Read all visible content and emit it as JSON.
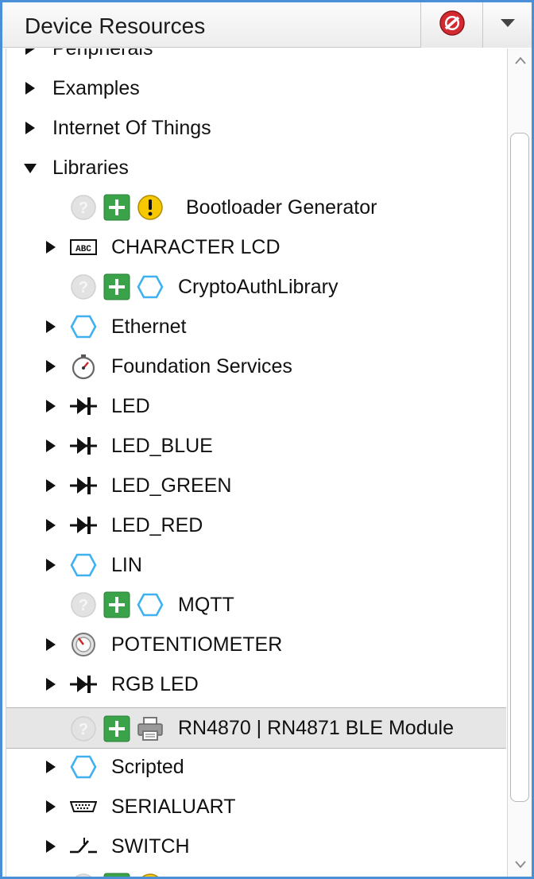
{
  "panel": {
    "title": "Device Resources"
  },
  "header": {
    "stop_icon": "stop-icon",
    "menu_icon": "chevron-down-icon"
  },
  "tree": {
    "partial_top_label": "Peripherals",
    "items": [
      {
        "label": "Examples",
        "icon": "none",
        "expand": "collapsed"
      },
      {
        "label": "Internet Of Things",
        "icon": "none",
        "expand": "collapsed"
      },
      {
        "label": "Libraries",
        "icon": "none",
        "expand": "expanded"
      },
      {
        "label": "Bootloader Generator",
        "icon": "warning-icon",
        "expand": "leaf"
      },
      {
        "label": "CHARACTER LCD",
        "icon": "lcd-icon",
        "expand": "collapsed"
      },
      {
        "label": "CryptoAuthLibrary",
        "icon": "hexagon-icon",
        "expand": "leaf"
      },
      {
        "label": "Ethernet",
        "icon": "hexagon-icon",
        "expand": "collapsed"
      },
      {
        "label": "Foundation Services",
        "icon": "stopwatch-icon",
        "expand": "collapsed"
      },
      {
        "label": "LED",
        "icon": "diode-icon",
        "expand": "collapsed"
      },
      {
        "label": "LED_BLUE",
        "icon": "diode-icon",
        "expand": "collapsed"
      },
      {
        "label": "LED_GREEN",
        "icon": "diode-icon",
        "expand": "collapsed"
      },
      {
        "label": "LED_RED",
        "icon": "diode-icon",
        "expand": "collapsed"
      },
      {
        "label": "LIN",
        "icon": "hexagon-icon",
        "expand": "collapsed"
      },
      {
        "label": "MQTT",
        "icon": "hexagon-icon",
        "expand": "leaf"
      },
      {
        "label": "POTENTIOMETER",
        "icon": "potentiometer-icon",
        "expand": "collapsed"
      },
      {
        "label": "RGB LED",
        "icon": "diode-icon",
        "expand": "collapsed"
      },
      {
        "label": "RN4870 | RN4871 BLE Module",
        "icon": "printer-icon",
        "expand": "leaf",
        "selected": true
      },
      {
        "label": "Scripted",
        "icon": "hexagon-icon",
        "expand": "collapsed"
      },
      {
        "label": "SERIALUART",
        "icon": "serial-port-icon",
        "expand": "collapsed"
      },
      {
        "label": "SWITCH",
        "icon": "switch-icon",
        "expand": "collapsed"
      }
    ]
  },
  "colors": {
    "accent_border": "#4a90d9",
    "add_green": "#3aa34a",
    "hexagon_blue": "#3fb0f0",
    "warning_yellow": "#f5c800",
    "stop_red": "#c8242b"
  }
}
